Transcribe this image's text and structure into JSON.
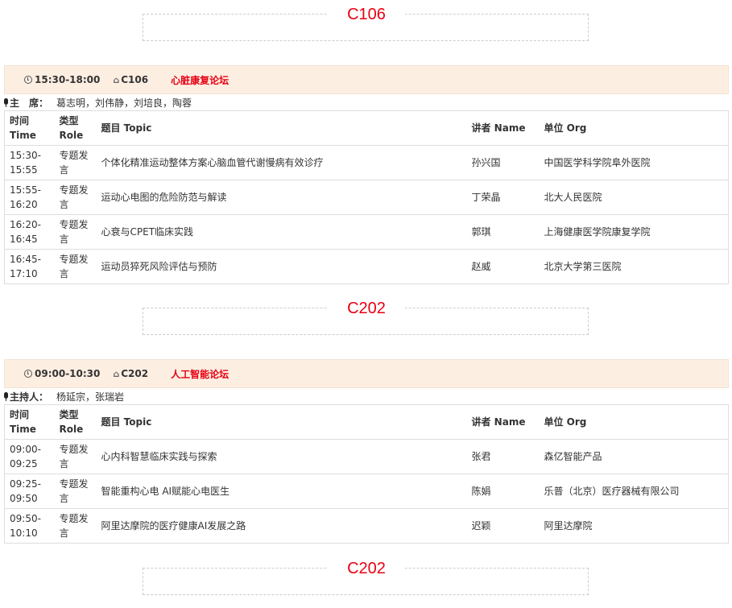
{
  "rooms": [
    {
      "label": "C106"
    },
    {
      "label": "C202"
    },
    {
      "label": "C202"
    }
  ],
  "sessions": [
    {
      "time": "15:30-18:00",
      "room": "C106",
      "title": "心脏康复论坛",
      "chair_label": "主　席：",
      "chairs": "葛志明，刘伟静，刘培良，陶蓉",
      "columns": {
        "time": "时间 Time",
        "role": "类型 Role",
        "topic": "题目 Topic",
        "speaker": "讲者 Name",
        "org": "单位 Org"
      },
      "rows": [
        {
          "time": "15:30-15:55",
          "role": "专题发言",
          "topic": "个体化精准运动整体方案心脑血管代谢慢病有效诊疗",
          "speaker": "孙兴国",
          "org": "中国医学科学院阜外医院"
        },
        {
          "time": "15:55-16:20",
          "role": "专题发言",
          "topic": "运动心电图的危险防范与解读",
          "speaker": "丁荣晶",
          "org": "北大人民医院"
        },
        {
          "time": "16:20-16:45",
          "role": "专题发言",
          "topic": "心衰与CPET临床实践",
          "speaker": "郭琪",
          "org": "上海健康医学院康复学院"
        },
        {
          "time": "16:45-17:10",
          "role": "专题发言",
          "topic": "运动员猝死风险评估与预防",
          "speaker": "赵威",
          "org": "北京大学第三医院"
        }
      ]
    },
    {
      "time": "09:00-10:30",
      "room": "C202",
      "title": "人工智能论坛",
      "chair_label": "主持人：",
      "chairs": "杨延宗，张瑞岩",
      "columns": {
        "time": "时间 Time",
        "role": "类型 Role",
        "topic": "题目 Topic",
        "speaker": "讲者 Name",
        "org": "单位 Org"
      },
      "rows": [
        {
          "time": "09:00-09:25",
          "role": "专题发言",
          "topic": "心内科智慧临床实践与探索",
          "speaker": "张君",
          "org": "森亿智能产品"
        },
        {
          "time": "09:25-09:50",
          "role": "专题发言",
          "topic": "智能重构心电 AI赋能心电医生",
          "speaker": "陈娟",
          "org": "乐普（北京）医疗器械有限公司"
        },
        {
          "time": "09:50-10:10",
          "role": "专题发言",
          "topic": "阿里达摩院的医疗健康AI发展之路",
          "speaker": "迟颖",
          "org": "阿里达摩院"
        }
      ]
    }
  ],
  "colors": {
    "accent": "#e60012",
    "header_bg": "#fdeee2",
    "border": "#dddddd"
  }
}
